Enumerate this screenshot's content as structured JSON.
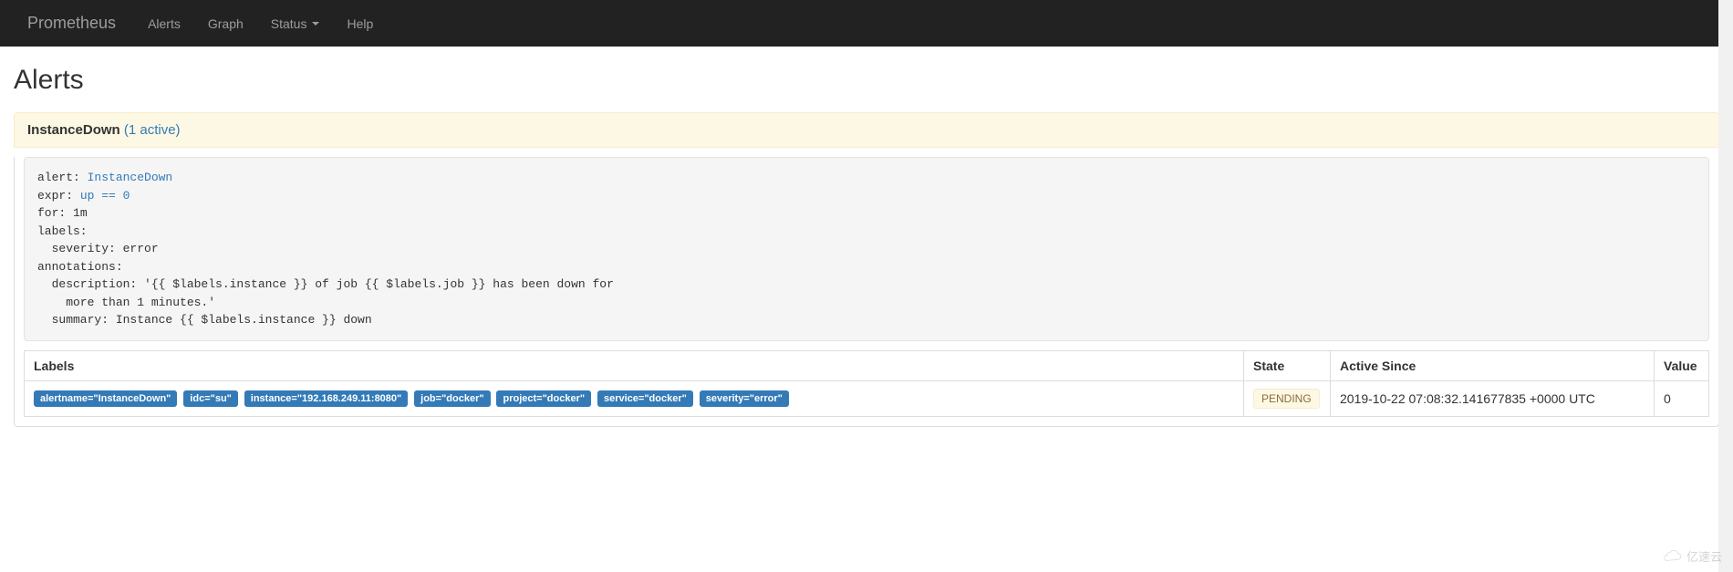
{
  "nav": {
    "brand": "Prometheus",
    "items": [
      "Alerts",
      "Graph",
      "Status",
      "Help"
    ],
    "has_dropdown": [
      false,
      false,
      true,
      false
    ]
  },
  "page_title": "Alerts",
  "alert_group": {
    "name": "InstanceDown",
    "active_text": "(1 active)",
    "rule_keys": {
      "alert": "alert:",
      "expr": "expr:",
      "for": "for:",
      "labels": "labels:",
      "severity": "  severity: error",
      "annotations": "annotations:",
      "description": "  description: '{{ $labels.instance }} of job {{ $labels.job }} has been down for\n    more than 1 minutes.'",
      "summary": "  summary: Instance {{ $labels.instance }} down"
    },
    "rule_values": {
      "alert": " InstanceDown",
      "expr": " up == 0",
      "for": " 1m"
    }
  },
  "table": {
    "headers": [
      "Labels",
      "State",
      "Active Since",
      "Value"
    ],
    "row": {
      "labels": [
        "alertname=\"InstanceDown\"",
        "idc=\"su\"",
        "instance=\"192.168.249.11:8080\"",
        "job=\"docker\"",
        "project=\"docker\"",
        "service=\"docker\"",
        "severity=\"error\""
      ],
      "state": "PENDING",
      "active_since": "2019-10-22 07:08:32.141677835 +0000 UTC",
      "value": "0"
    }
  },
  "watermark": "亿速云"
}
